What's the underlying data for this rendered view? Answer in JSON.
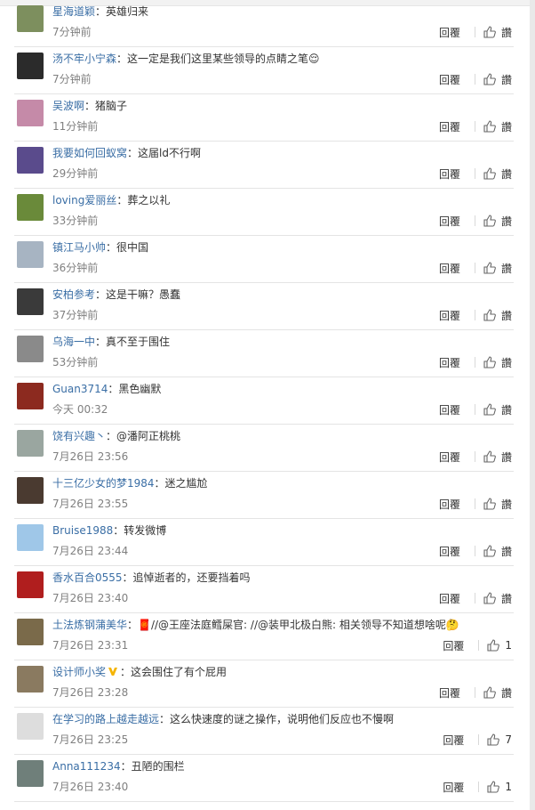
{
  "comments": [
    {
      "name": "星海道颖",
      "text": "：英雄归来",
      "time": "7分钟前",
      "reply": "回覆",
      "like": "讚",
      "avatar": "#7d8f5e"
    },
    {
      "name": "汤不牢小宁森",
      "text": "：这一定是我们这里某些领导的点睛之笔😌",
      "time": "7分钟前",
      "reply": "回覆",
      "like": "讚",
      "avatar": "#2b2b2b"
    },
    {
      "name": "吴波啊",
      "text": "：猪脑子",
      "time": "11分钟前",
      "reply": "回覆",
      "like": "讚",
      "avatar": "#c58aa8"
    },
    {
      "name": "我要如何回蚁窝",
      "text": "：这届ld不行啊",
      "time": "29分钟前",
      "reply": "回覆",
      "like": "讚",
      "avatar": "#5a4b8c"
    },
    {
      "name": "loving爱丽丝",
      "text": "：葬之以礼",
      "time": "33分钟前",
      "reply": "回覆",
      "like": "讚",
      "avatar": "#6a8a3a"
    },
    {
      "name": "镇江马小帅",
      "text": "：很中国",
      "time": "36分钟前",
      "reply": "回覆",
      "like": "讚",
      "avatar": "#a7b4c2"
    },
    {
      "name": "安柏参考",
      "text": "：这是干嘛？愚蠢",
      "time": "37分钟前",
      "reply": "回覆",
      "like": "讚",
      "avatar": "#3a3a3a"
    },
    {
      "name": "乌海一中",
      "text": "：真不至于围住",
      "time": "53分钟前",
      "reply": "回覆",
      "like": "讚",
      "avatar": "#8a8a8a"
    },
    {
      "name": "Guan3714",
      "text": "：黑色幽默",
      "time": "今天 00:32",
      "reply": "回覆",
      "like": "讚",
      "avatar": "#8c2a1f"
    },
    {
      "name": "饶有兴趣丶",
      "text": "：@潘阿正桃桃",
      "time": "7月26日 23:56",
      "reply": "回覆",
      "like": "讚",
      "avatar": "#9aa6a0"
    },
    {
      "name": "十三亿少女的梦1984",
      "text": "：迷之尴尬",
      "time": "7月26日 23:55",
      "reply": "回覆",
      "like": "讚",
      "avatar": "#4a3a30"
    },
    {
      "name": "Bruise1988",
      "text": "：转发微博",
      "time": "7月26日 23:44",
      "reply": "回覆",
      "like": "讚",
      "avatar": "#9fc7e8"
    },
    {
      "name": "香水百合0555",
      "text": "：追悼逝者的，还要挡着吗",
      "time": "7月26日 23:40",
      "reply": "回覆",
      "like": "讚",
      "avatar": "#b01e1e"
    },
    {
      "name": "土法炼钢蒲美华",
      "text": "：🧧//@王座法庭鳕屎官: //@装甲北极白熊: 相关领导不知道想啥呢🤔",
      "time": "7月26日 23:31",
      "reply": "回覆",
      "like": "1",
      "avatar": "#7a6a4a"
    },
    {
      "name": "设计师小奖",
      "text": "：这会围住了有个屁用",
      "time": "7月26日 23:28",
      "reply": "回覆",
      "like": "讚",
      "avatar": "#8a7a60"
    },
    {
      "name": "在学习的路上越走越远",
      "text": "：这么快速度的谜之操作，说明他们反应也不慢啊",
      "time": "7月26日 23:25",
      "reply": "回覆",
      "like": "7",
      "avatar": "#dddddd"
    },
    {
      "name": "Anna111234",
      "text": "：丑陋的围栏",
      "time": "7月26日 23:40",
      "reply": "回覆",
      "like": "1",
      "avatar": "#6f7f7a"
    }
  ]
}
